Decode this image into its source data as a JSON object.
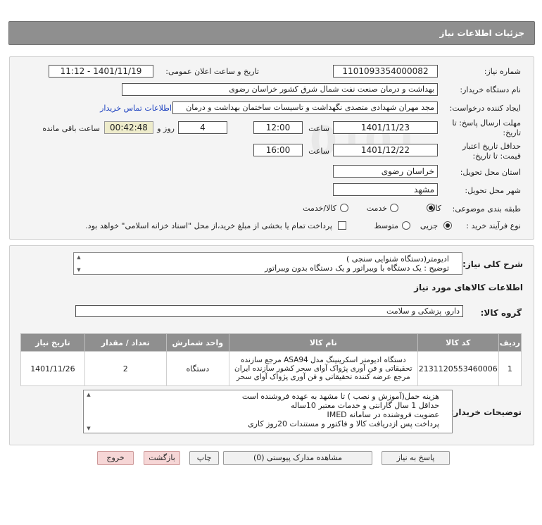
{
  "header": {
    "title": "جزئیات اطلاعات نیاز"
  },
  "form": {
    "need_number_label": "شماره نیاز:",
    "need_number": "1101093354000082",
    "announce_label": "تاریخ و ساعت اعلان عمومی:",
    "announce_value": "1401/11/19 - 11:12",
    "buyer_label": "نام دستگاه خریدار:",
    "buyer_value": "بهداشت و درمان صنعت نفت شمال شرق کشور   خراسان رضوی",
    "creator_label": "ایجاد کننده درخواست:",
    "creator_value": "مجد مهران شهدادی متصدی نگهداشت و تاسیسات ساختمان بهداشت و درمان",
    "contact_link": "اطلاعات تماس خریدار",
    "deadline_label_1": "مهلت ارسال پاسخ: تا",
    "deadline_label_2": "تاریخ:",
    "deadline_date": "1401/11/23",
    "time_label": "ساعت",
    "deadline_time": "12:00",
    "days_value": "4",
    "days_label": "روز و",
    "remaining_time": "00:42:48",
    "remaining_label": "ساعت باقی مانده",
    "validity_label_1": "حداقل تاریخ اعتبار",
    "validity_label_2": "قیمت: تا تاریخ:",
    "validity_date": "1401/12/22",
    "validity_time": "16:00",
    "province_label": "استان محل تحویل:",
    "province_value": "خراسان رضوی",
    "city_label": "شهر محل تحویل:",
    "city_value": "مشهد",
    "category_label": "طبقه بندی موضوعی:",
    "category_options": [
      "کالا",
      "خدمت",
      "کالا/خدمت"
    ],
    "category_selected": "کالا",
    "process_label": "نوع فرآیند خرید :",
    "process_options": [
      "جزیی",
      "متوسط"
    ],
    "process_selected": "جزیی",
    "payment_note": "پرداخت تمام یا بخشی از مبلغ خرید،از محل \"اسناد خزانه اسلامی\" خواهد بود."
  },
  "summary": {
    "label": "شرح کلی نیاز:",
    "lines": [
      "ادیومتر(دستگاه شنوایی سنجی )",
      "توضیح : یک دستگاه با ویبراتور و یک دستگاه بدون ویبراتور"
    ]
  },
  "goods": {
    "section_title": "اطلاعات کالاهای مورد نیاز",
    "group_label": "گروه کالا:",
    "group_value": "دارو، پزشکی و سلامت",
    "columns": [
      "ردیف",
      "کد کالا",
      "نام کالا",
      "واحد شمارش",
      "تعداد / مقدار",
      "تاریخ نیاز"
    ],
    "rows": [
      {
        "index": "1",
        "code": "2131120553460006",
        "name_lines": [
          "دستگاه ادیومتر اسکرینینگ مدل ASA94 مرجع سازنده",
          "تحقیقاتی و فن آوری پژواک آوای سحر کشور سازنده ایران",
          "مرجع عرضه کننده تحقیقاتی و فن آوری پژواک آوای سحر"
        ],
        "unit": "دستگاه",
        "qty": "2",
        "date": "1401/11/26"
      }
    ]
  },
  "buyer_notes": {
    "label": "توضیحات خریدار:",
    "lines": [
      "هزینه حمل(آموزش و نصب ) تا مشهد به عهده فروشنده است",
      "حداقل 1 سال گارانتی و خدمات معتبر 10ساله",
      "عضویت فروشنده در سامانه IMED",
      "پرداخت پس ازدریافت کالا و فاکتور و مستندات 20روز کاری"
    ]
  },
  "buttons": {
    "respond": "پاسخ به نیاز",
    "attachments": "مشاهده مدارک پیوستی (0)",
    "print": "چاپ",
    "back": "بازگشت",
    "exit": "خروج"
  },
  "watermark": {
    "brand": "ParsNamadData",
    "fa_line_1": "پایگاه اطلاع رسانی مناقصه",
    "fa_line_2": "فراوری اطلاعات پارس نماد داده ها",
    "phone": "۰۲۱-۸۸۳۴۹۶۷۰",
    "digits": "0101"
  }
}
